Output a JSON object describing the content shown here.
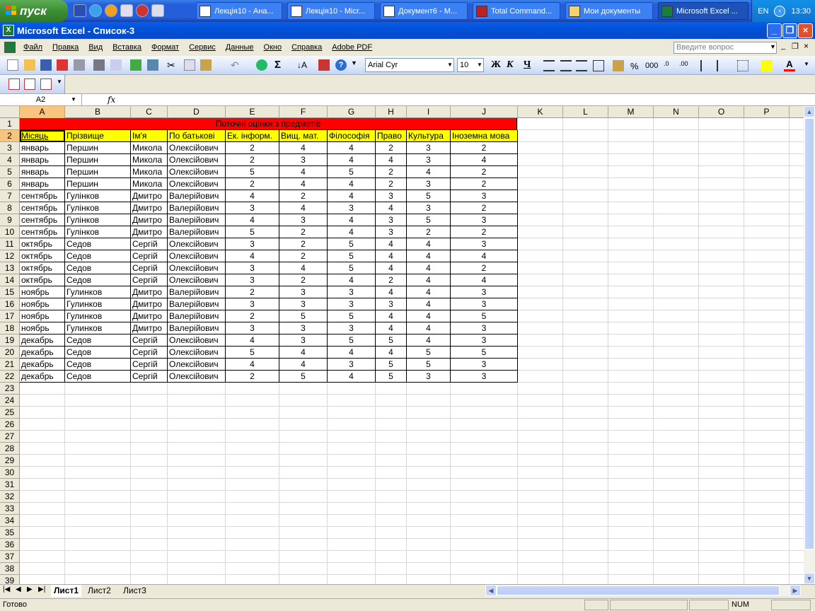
{
  "taskbar": {
    "start_label": "пуск",
    "buttons": [
      {
        "label": "Лекція10 - Ана..."
      },
      {
        "label": "Лекція10 - Micr..."
      },
      {
        "label": "Документ6 - M..."
      },
      {
        "label": "Total Command..."
      },
      {
        "label": "Мои документы"
      },
      {
        "label": "Microsoft Excel ..."
      }
    ],
    "lang": "EN",
    "clock": "13:30"
  },
  "window": {
    "title": "Microsoft Excel - Список-3"
  },
  "menu": {
    "items": [
      "Файл",
      "Правка",
      "Вид",
      "Вставка",
      "Формат",
      "Сервис",
      "Данные",
      "Окно",
      "Справка",
      "Adobe PDF"
    ],
    "ask_placeholder": "Введите вопрос"
  },
  "toolbar": {
    "font_name": "Arial Cyr",
    "font_size": "10",
    "bold": "Ж",
    "italic": "К",
    "underline": "Ч",
    "percent": "%",
    "thousands": "000"
  },
  "formula_bar": {
    "name_box": "A2",
    "fx": "fx",
    "content": ""
  },
  "sheet": {
    "columns": [
      "A",
      "B",
      "C",
      "D",
      "E",
      "F",
      "G",
      "H",
      "I",
      "J",
      "K",
      "L",
      "M",
      "N",
      "O",
      "P"
    ],
    "row_numbers": [
      "1",
      "2",
      "3",
      "4",
      "5",
      "6",
      "7",
      "8",
      "9",
      "10",
      "11",
      "12",
      "13",
      "14",
      "15",
      "16",
      "17",
      "18",
      "19",
      "20",
      "21",
      "22",
      "23",
      "24",
      "25",
      "26",
      "27",
      "28",
      "29",
      "30",
      "31",
      "32",
      "33",
      "34",
      "35",
      "36",
      "37",
      "38",
      "39"
    ],
    "title": "Поточні оцінки з предметів",
    "headers": [
      "Місяць",
      "Прізвище",
      "Ім'я",
      "По батькові",
      "Ек. інформ.",
      "Вищ. мат.",
      "Філософія",
      "Право",
      "Культура",
      "Іноземна мова"
    ],
    "rows": [
      [
        "январь",
        "Першин",
        "Микола",
        "Олексійович",
        "2",
        "4",
        "4",
        "2",
        "3",
        "2"
      ],
      [
        "январь",
        "Першин",
        "Микола",
        "Олексійович",
        "2",
        "3",
        "4",
        "4",
        "3",
        "4"
      ],
      [
        "январь",
        "Першин",
        "Микола",
        "Олексійович",
        "5",
        "4",
        "5",
        "2",
        "4",
        "2"
      ],
      [
        "январь",
        "Першин",
        "Микола",
        "Олексійович",
        "2",
        "4",
        "4",
        "2",
        "3",
        "2"
      ],
      [
        "сентябрь",
        "Гулінков",
        "Дмитро",
        "Валерійович",
        "4",
        "2",
        "4",
        "3",
        "5",
        "3"
      ],
      [
        "сентябрь",
        "Гулінков",
        "Дмитро",
        "Валерійович",
        "3",
        "4",
        "3",
        "4",
        "3",
        "2"
      ],
      [
        "сентябрь",
        "Гулінков",
        "Дмитро",
        "Валерійович",
        "4",
        "3",
        "4",
        "3",
        "5",
        "3"
      ],
      [
        "сентябрь",
        "Гулінков",
        "Дмитро",
        "Валерійович",
        "5",
        "2",
        "4",
        "3",
        "2",
        "2"
      ],
      [
        "октябрь",
        "Седов",
        "Сергій",
        "Олексійович",
        "3",
        "2",
        "5",
        "4",
        "4",
        "3"
      ],
      [
        "октябрь",
        "Седов",
        "Сергій",
        "Олексійович",
        "4",
        "2",
        "5",
        "4",
        "4",
        "4"
      ],
      [
        "октябрь",
        "Седов",
        "Сергій",
        "Олексійович",
        "3",
        "4",
        "5",
        "4",
        "4",
        "2"
      ],
      [
        "октябрь",
        "Седов",
        "Сергій",
        "Олексійович",
        "3",
        "2",
        "4",
        "2",
        "4",
        "4"
      ],
      [
        "ноябрь",
        "Гулинков",
        "Дмитро",
        "Валерійович",
        "2",
        "3",
        "3",
        "4",
        "4",
        "3"
      ],
      [
        "ноябрь",
        "Гулинков",
        "Дмитро",
        "Валерійович",
        "3",
        "3",
        "3",
        "3",
        "4",
        "3"
      ],
      [
        "ноябрь",
        "Гулинков",
        "Дмитро",
        "Валерійович",
        "2",
        "5",
        "5",
        "4",
        "4",
        "5"
      ],
      [
        "ноябрь",
        "Гулинков",
        "Дмитро",
        "Валерійович",
        "3",
        "3",
        "3",
        "4",
        "4",
        "3"
      ],
      [
        "декабрь",
        "Седов",
        "Сергій",
        "Олексійович",
        "4",
        "3",
        "5",
        "5",
        "4",
        "3"
      ],
      [
        "декабрь",
        "Седов",
        "Сергій",
        "Олексійович",
        "5",
        "4",
        "4",
        "4",
        "5",
        "5"
      ],
      [
        "декабрь",
        "Седов",
        "Сергій",
        "Олексійович",
        "4",
        "4",
        "3",
        "5",
        "5",
        "3"
      ],
      [
        "декабрь",
        "Седов",
        "Сергій",
        "Олексійович",
        "2",
        "5",
        "4",
        "5",
        "3",
        "3"
      ]
    ],
    "tabs": [
      "Лист1",
      "Лист2",
      "Лист3"
    ],
    "active_tab": "Лист1"
  },
  "status": {
    "ready": "Готово",
    "num": "NUM"
  },
  "colors": {
    "title_fill": "#ff0000",
    "header_fill": "#ffff00",
    "xp_blue": "#245edb"
  }
}
